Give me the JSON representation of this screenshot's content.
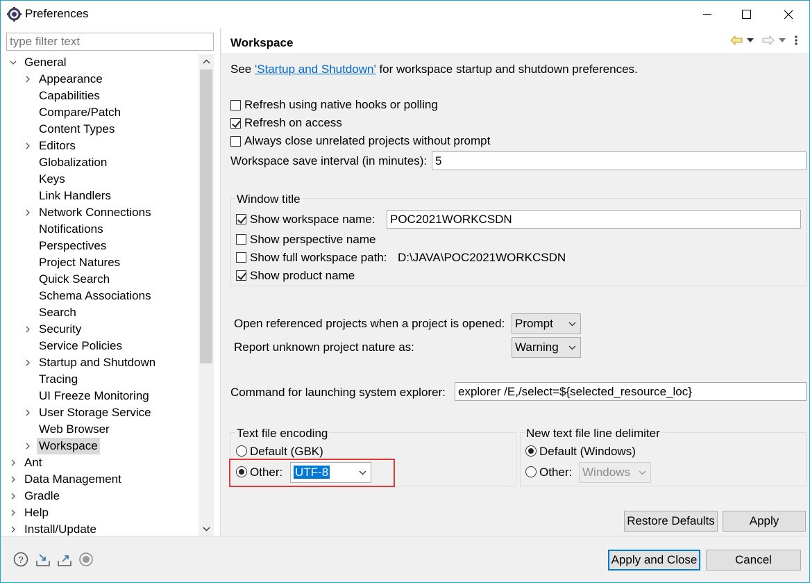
{
  "window": {
    "title": "Preferences",
    "accent": "#1aa7c9"
  },
  "filter": {
    "placeholder": "type filter text"
  },
  "tree": [
    {
      "label": "General",
      "arrow": "open",
      "level": 0
    },
    {
      "label": "Appearance",
      "arrow": "closed",
      "level": 1
    },
    {
      "label": "Capabilities",
      "arrow": "",
      "level": 1
    },
    {
      "label": "Compare/Patch",
      "arrow": "",
      "level": 1
    },
    {
      "label": "Content Types",
      "arrow": "",
      "level": 1
    },
    {
      "label": "Editors",
      "arrow": "closed",
      "level": 1
    },
    {
      "label": "Globalization",
      "arrow": "",
      "level": 1
    },
    {
      "label": "Keys",
      "arrow": "",
      "level": 1
    },
    {
      "label": "Link Handlers",
      "arrow": "",
      "level": 1
    },
    {
      "label": "Network Connections",
      "arrow": "closed",
      "level": 1
    },
    {
      "label": "Notifications",
      "arrow": "",
      "level": 1
    },
    {
      "label": "Perspectives",
      "arrow": "",
      "level": 1
    },
    {
      "label": "Project Natures",
      "arrow": "",
      "level": 1
    },
    {
      "label": "Quick Search",
      "arrow": "",
      "level": 1
    },
    {
      "label": "Schema Associations",
      "arrow": "",
      "level": 1
    },
    {
      "label": "Search",
      "arrow": "",
      "level": 1
    },
    {
      "label": "Security",
      "arrow": "closed",
      "level": 1
    },
    {
      "label": "Service Policies",
      "arrow": "",
      "level": 1
    },
    {
      "label": "Startup and Shutdown",
      "arrow": "closed",
      "level": 1
    },
    {
      "label": "Tracing",
      "arrow": "",
      "level": 1
    },
    {
      "label": "UI Freeze Monitoring",
      "arrow": "",
      "level": 1
    },
    {
      "label": "User Storage Service",
      "arrow": "closed",
      "level": 1
    },
    {
      "label": "Web Browser",
      "arrow": "",
      "level": 1
    },
    {
      "label": "Workspace",
      "arrow": "closed",
      "level": 1,
      "selected": true
    },
    {
      "label": "Ant",
      "arrow": "closed",
      "level": 0
    },
    {
      "label": "Data Management",
      "arrow": "closed",
      "level": 0
    },
    {
      "label": "Gradle",
      "arrow": "closed",
      "level": 0
    },
    {
      "label": "Help",
      "arrow": "closed",
      "level": 0
    },
    {
      "label": "Install/Update",
      "arrow": "closed",
      "level": 0
    }
  ],
  "page": {
    "title": "Workspace",
    "intro_prefix": "See ",
    "intro_link": "'Startup and Shutdown'",
    "intro_suffix": " for workspace startup and shutdown preferences.",
    "refresh_native": {
      "label": "Refresh using native hooks or polling",
      "checked": false
    },
    "refresh_access": {
      "label": "Refresh on access",
      "checked": true
    },
    "always_close": {
      "label": "Always close unrelated projects without prompt",
      "checked": false
    },
    "save_interval_label": "Workspace save interval (in minutes):",
    "save_interval_value": "5",
    "window_title": {
      "group_label": "Window title",
      "show_ws_name_label": "Show workspace name:",
      "show_ws_name_value": "POC2021WORKCSDN",
      "show_perspective_label": "Show perspective name",
      "show_full_path_label": "Show full workspace path:",
      "full_path_value": "D:\\JAVA\\POC2021WORKCSDN",
      "show_product_label": "Show product name"
    },
    "open_ref_label": "Open referenced projects when a project is opened:",
    "open_ref_value": "Prompt",
    "report_nature_label": "Report unknown project nature as:",
    "report_nature_value": "Warning",
    "explorer_label": "Command for launching system explorer:",
    "explorer_value": "explorer /E,/select=${selected_resource_loc}",
    "encoding": {
      "group_label": "Text file encoding",
      "default_label": "Default (GBK)",
      "other_label": "Other:",
      "other_value": "UTF-8"
    },
    "delimiter": {
      "group_label": "New text file line delimiter",
      "default_label": "Default (Windows)",
      "other_label": "Other:",
      "other_value": "Windows"
    },
    "restore_defaults": "Restore Defaults",
    "apply": "Apply"
  },
  "footer": {
    "apply_close": "Apply and Close",
    "cancel": "Cancel",
    "icons": [
      "help-icon",
      "import-icon",
      "export-icon",
      "oomph-record-icon"
    ]
  }
}
